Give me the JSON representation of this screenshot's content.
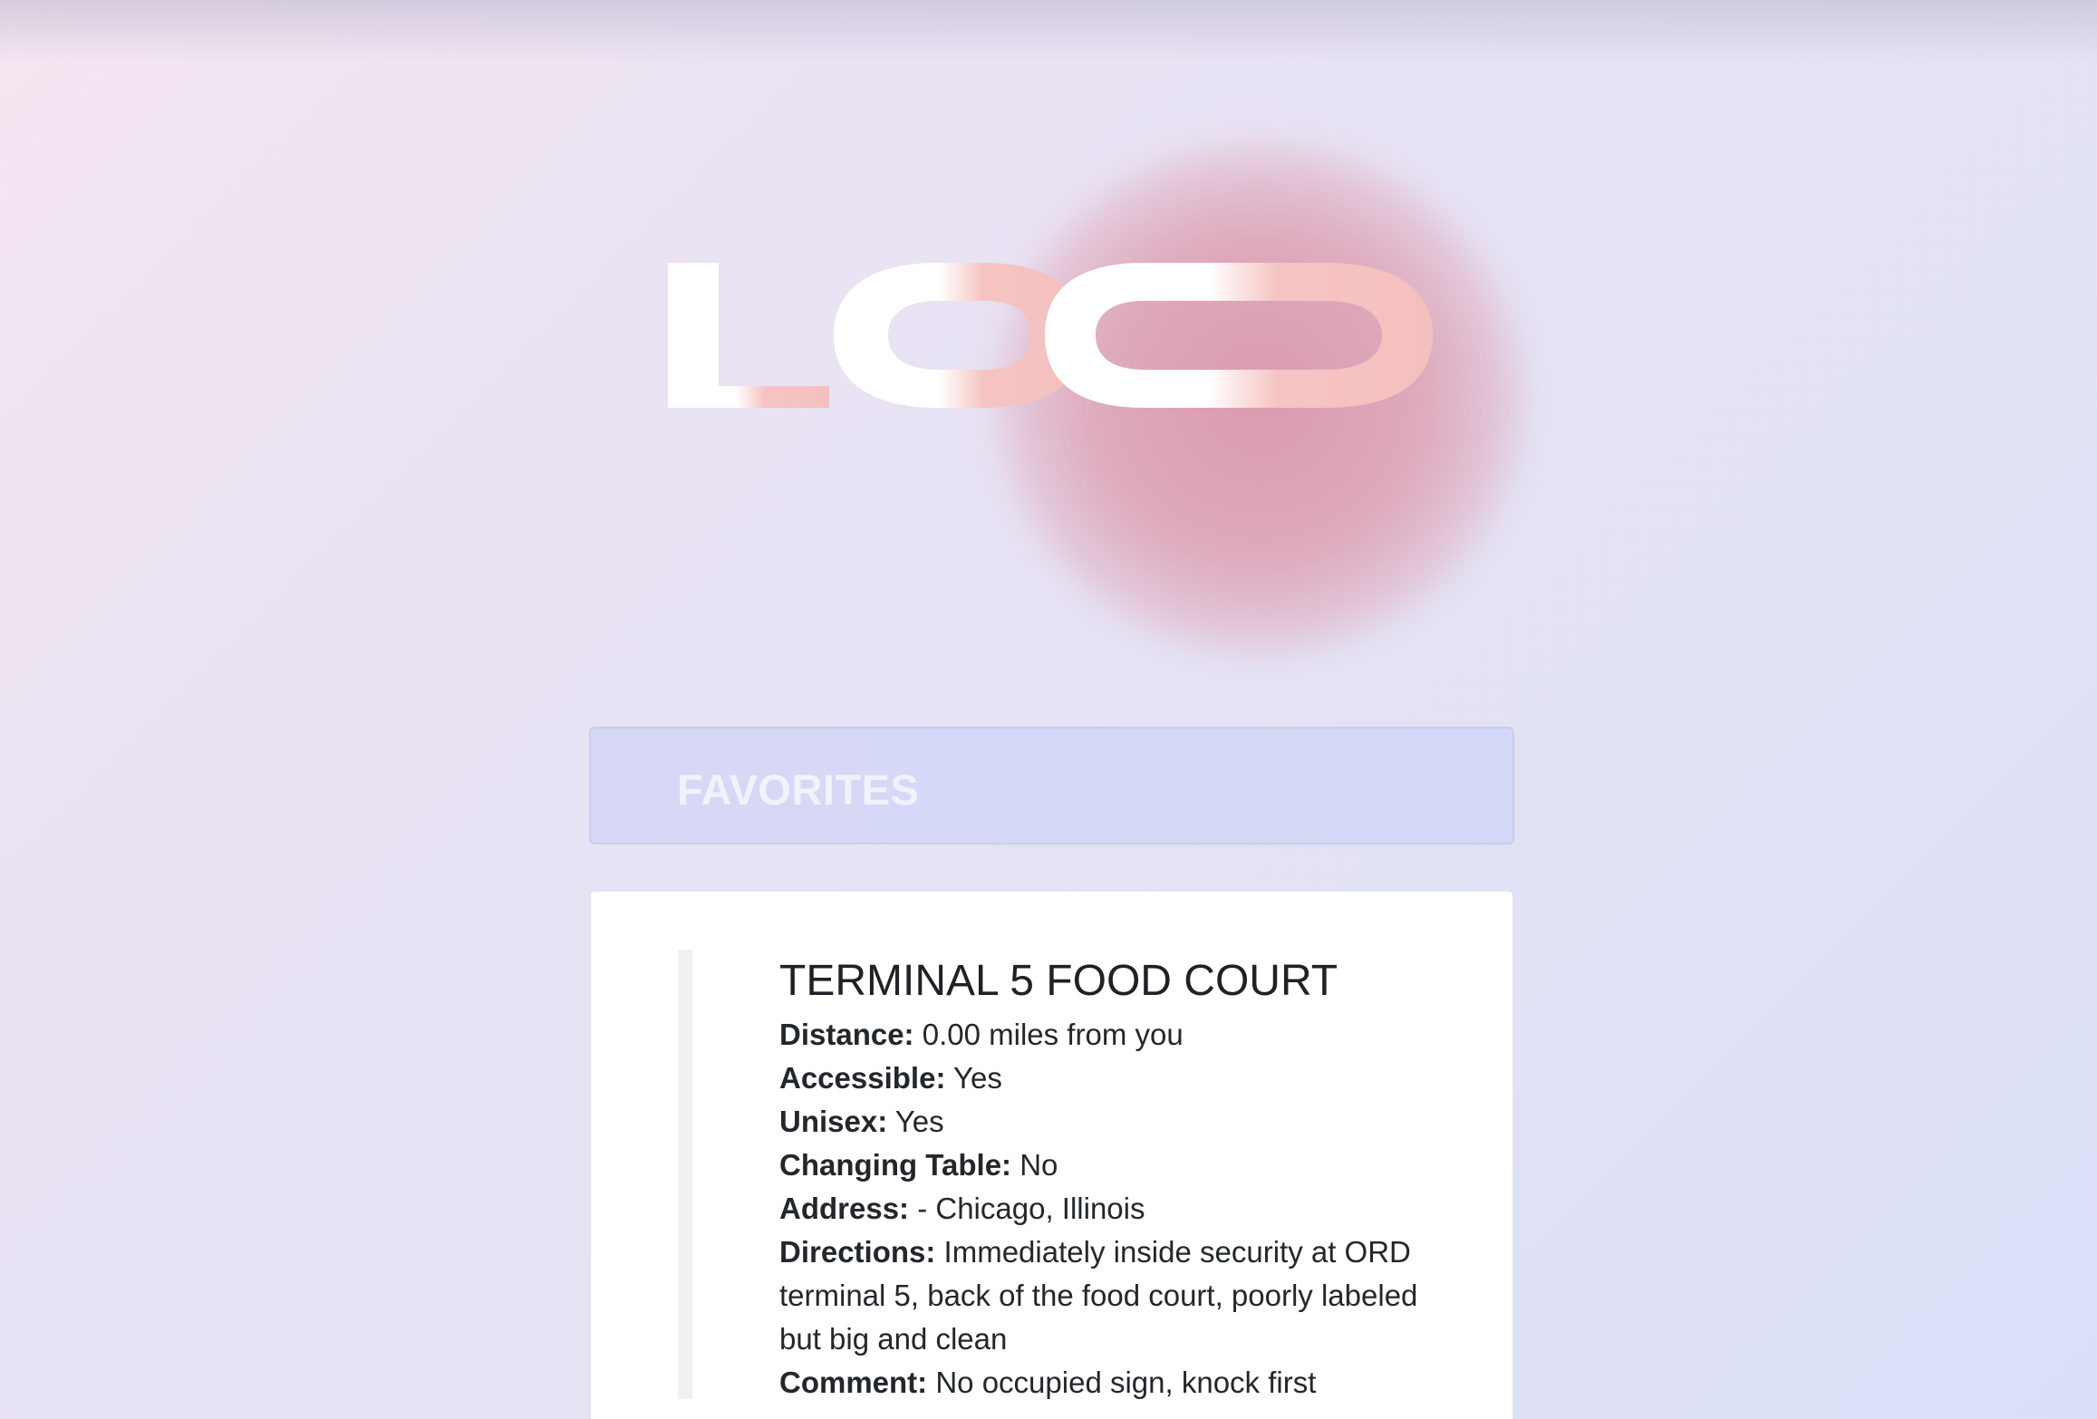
{
  "brand": {
    "logo_text": "LOO",
    "logo_primary_color": "#ffffff",
    "logo_accent_color": "#f5c2c0",
    "blob_color": "#dca0b2"
  },
  "favorites": {
    "title": "FAVORITES"
  },
  "listing": {
    "title": "TERMINAL 5 FOOD COURT",
    "fields": [
      {
        "label": "Distance:",
        "value": "0.00 miles from you"
      },
      {
        "label": "Accessible:",
        "value": "Yes"
      },
      {
        "label": "Unisex:",
        "value": "Yes"
      },
      {
        "label": "Changing Table:",
        "value": "No"
      },
      {
        "label": "Address:",
        "value": "- Chicago, Illinois"
      },
      {
        "label": "Directions:",
        "value": "Immediately inside security at ORD terminal 5, back of the food court, poorly labeled but big and clean"
      },
      {
        "label": "Comment:",
        "value": "No occupied sign, knock first"
      }
    ]
  }
}
